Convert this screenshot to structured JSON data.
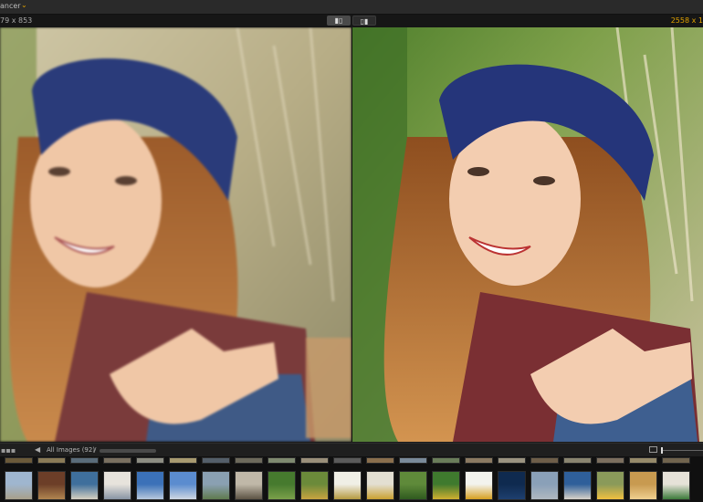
{
  "app": {
    "title_fragment": "ancer"
  },
  "info": {
    "left_dims": "79 x 853",
    "right_dims": "2558 x 1"
  },
  "compare_modes": [
    {
      "name": "split-view"
    },
    {
      "name": "side-by-side"
    }
  ],
  "filmstrip": {
    "folder_label": "All Images (92)",
    "separator": "/"
  },
  "colors": {
    "accent": "#e0a100"
  }
}
